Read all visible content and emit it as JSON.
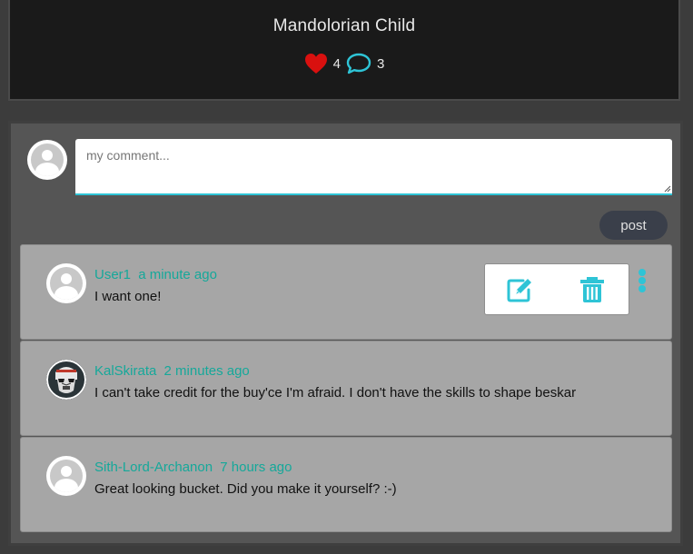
{
  "post": {
    "title": "Mandolorian Child",
    "likes": "4",
    "comments_count": "3",
    "like_icon": "heart-icon",
    "comment_icon": "speech-bubble-icon"
  },
  "composer": {
    "placeholder": "my comment...",
    "value": "",
    "post_label": "post"
  },
  "comments": [
    {
      "author": "User1",
      "time": "a minute ago",
      "text": "I want one!",
      "avatar": "default-avatar",
      "actions_open": true
    },
    {
      "author": "KalSkirata",
      "time": "2 minutes ago",
      "text": "I can't take credit for the buy'ce I'm afraid. I don't have the skills to shape beskar",
      "avatar": "stormtrooper-avatar"
    },
    {
      "author": "Sith-Lord-Archanon",
      "time": "7 hours ago",
      "text": "Great looking bucket. Did you make it yourself? :-)",
      "avatar": "default-avatar"
    }
  ],
  "colors": {
    "accent": "#2ec4d6",
    "author": "#15a89a",
    "like": "#d9100f",
    "header_bg": "#1a1a1a",
    "panel_bg": "#555555",
    "comment_bg": "#a6a6a6"
  }
}
